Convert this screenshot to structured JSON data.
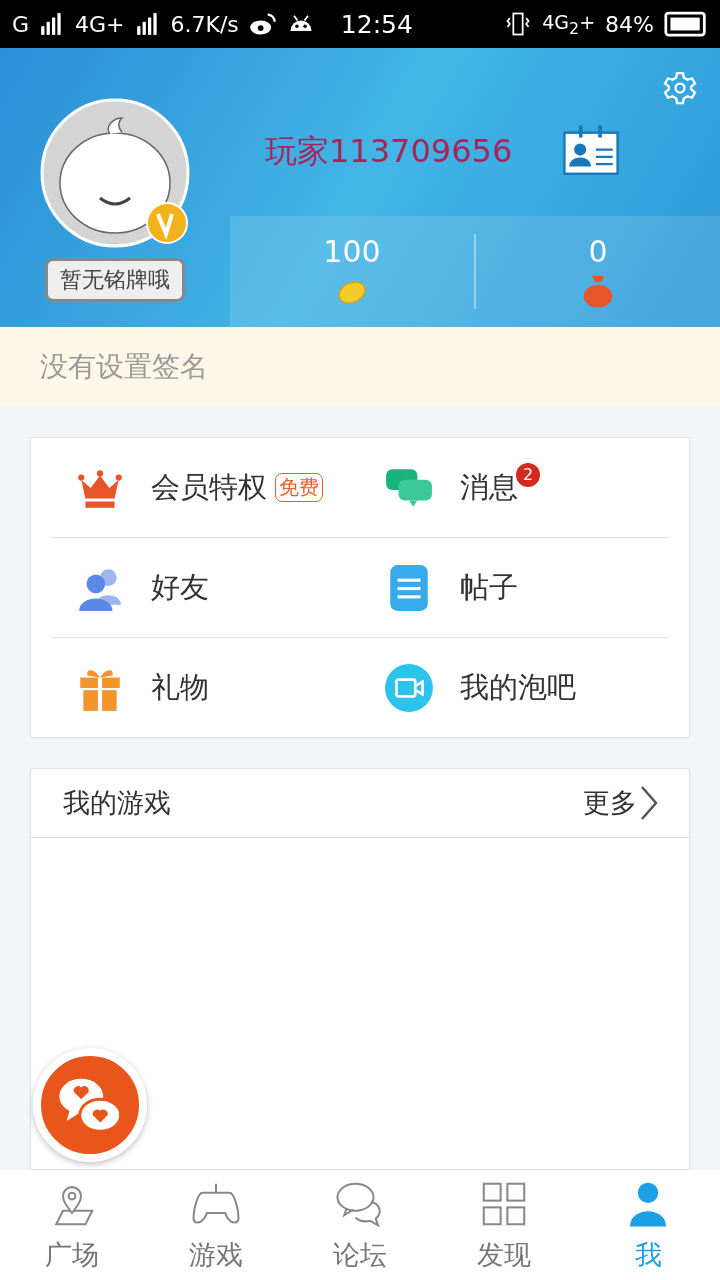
{
  "status_bar": {
    "carrier": "G",
    "network": "4G+",
    "speed": "6.7K/s",
    "time": "12:54",
    "network_2": "4G$_{2}$+",
    "battery": "84%"
  },
  "profile": {
    "badge_label": "暂无铭牌哦",
    "username": "玩家113709656",
    "stats": [
      {
        "value": "100",
        "kind": "bean"
      },
      {
        "value": "0",
        "kind": "bag"
      }
    ]
  },
  "signature": "没有设置签名",
  "menu": [
    {
      "label": "会员特权",
      "kind": "crown",
      "tag": "免费"
    },
    {
      "label": "消息",
      "kind": "chat",
      "count": "2"
    },
    {
      "label": "好友",
      "kind": "friends"
    },
    {
      "label": "帖子",
      "kind": "posts"
    },
    {
      "label": "礼物",
      "kind": "gift"
    },
    {
      "label": "我的泡吧",
      "kind": "video"
    }
  ],
  "games": {
    "title": "我的游戏",
    "more": "更多"
  },
  "tabs": [
    {
      "label": "广场",
      "kind": "map",
      "selected": false
    },
    {
      "label": "游戏",
      "kind": "gamepad",
      "selected": false
    },
    {
      "label": "论坛",
      "kind": "bubbles",
      "selected": false
    },
    {
      "label": "发现",
      "kind": "grid",
      "selected": false
    },
    {
      "label": "我",
      "kind": "person",
      "selected": true
    }
  ]
}
